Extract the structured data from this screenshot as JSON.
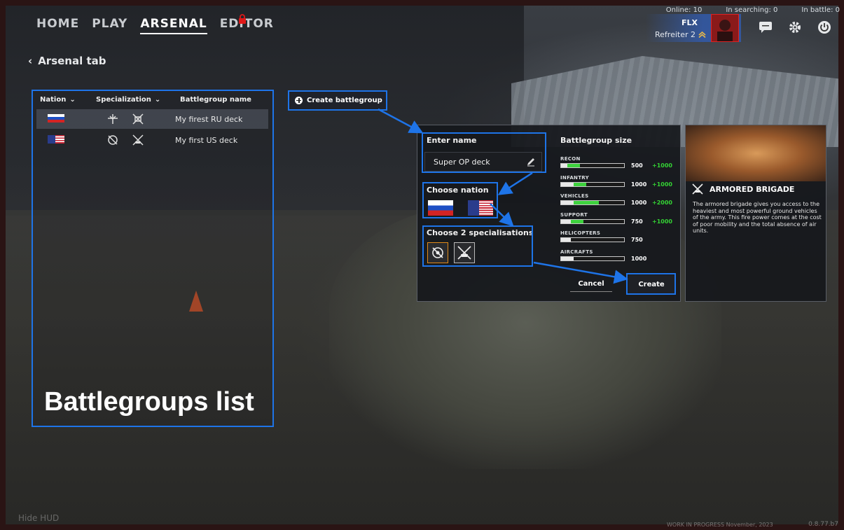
{
  "nav": {
    "items": [
      {
        "label": "HOME",
        "active": false
      },
      {
        "label": "PLAY",
        "active": false
      },
      {
        "label": "ARSENAL",
        "active": true
      },
      {
        "label": "EDITOR",
        "active": false,
        "locked": true
      }
    ],
    "back_label": "Arsenal tab"
  },
  "status": {
    "online": "Online: 10",
    "searching": "In searching: 0",
    "in_battle": "In battle: 0"
  },
  "user": {
    "name": "FLX",
    "rank": "Refreiter 2"
  },
  "top_icons": [
    "chat-icon",
    "gear-icon",
    "power-icon"
  ],
  "list": {
    "headers": {
      "nation": "Nation",
      "specialization": "Specialization",
      "name": "Battlegroup name"
    },
    "rows": [
      {
        "flag": "ru",
        "name": "My firest RU deck",
        "specs": [
          "airborne-icon",
          "tank-icon"
        ]
      },
      {
        "flag": "us",
        "name": "My first US deck",
        "specs": [
          "marine-icon",
          "armor-icon"
        ]
      }
    ],
    "big_label": "Battlegroups list"
  },
  "create_battlegroup_label": "Create battlegroup",
  "dialog": {
    "enter_name_title": "Enter name",
    "name_value": "Super OP deck",
    "choose_nation_title": "Choose nation",
    "choose_spec_title": "Choose 2 specialisations",
    "size_title": "Battlegroup size",
    "sizes": [
      {
        "label": "RECON",
        "value": "500",
        "bonus": "+1000",
        "base_fraction": 0.1,
        "extra_fraction": 0.2
      },
      {
        "label": "INFANTRY",
        "value": "1000",
        "bonus": "+1000",
        "base_fraction": 0.2,
        "extra_fraction": 0.2
      },
      {
        "label": "VEHICLES",
        "value": "1000",
        "bonus": "+2000",
        "base_fraction": 0.2,
        "extra_fraction": 0.4
      },
      {
        "label": "SUPPORT",
        "value": "750",
        "bonus": "+1000",
        "base_fraction": 0.15,
        "extra_fraction": 0.2
      },
      {
        "label": "HELICOPTERS",
        "value": "750",
        "bonus": "",
        "base_fraction": 0.15,
        "extra_fraction": 0
      },
      {
        "label": "AIRCRAFTS",
        "value": "1000",
        "bonus": "",
        "base_fraction": 0.2,
        "extra_fraction": 0
      }
    ],
    "cancel_label": "Cancel",
    "create_label": "Create"
  },
  "info": {
    "title": "ARMORED BRIGADE",
    "description": "The armored brigade gives you access to the heaviest and most powerful ground vehicles of the army. This fire power comes at the cost of poor mobility and the total absence of air units."
  },
  "footer": {
    "hide_hud": "Hide HUD",
    "wip": "WORK IN PROGRESS November, 2023",
    "version": "0.8.77.b7"
  },
  "colors": {
    "annotation": "#1e74e8",
    "bonus": "#34d234",
    "selected_spec_border": "#e08a1a"
  }
}
